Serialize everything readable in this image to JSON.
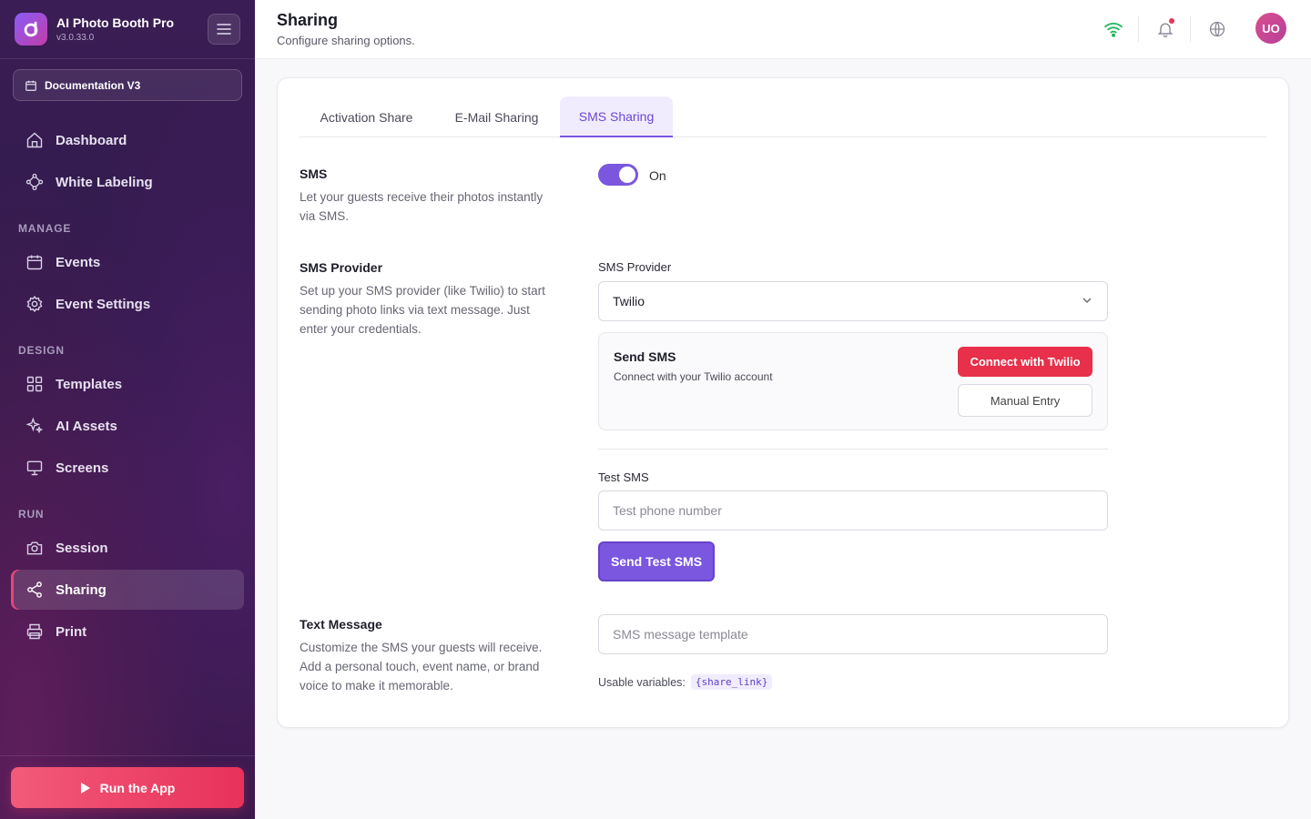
{
  "app": {
    "name": "AI Photo Booth Pro",
    "version": "v3.0.33.0"
  },
  "sidebar": {
    "project": "Documentation V3",
    "items_top": [
      {
        "label": "Dashboard",
        "icon": "home-icon"
      },
      {
        "label": "White Labeling",
        "icon": "white-label-icon"
      }
    ],
    "manage_label": "MANAGE",
    "manage_items": [
      {
        "label": "Events",
        "icon": "calendar-icon"
      },
      {
        "label": "Event Settings",
        "icon": "gear-icon"
      }
    ],
    "design_label": "DESIGN",
    "design_items": [
      {
        "label": "Templates",
        "icon": "grid-icon"
      },
      {
        "label": "AI Assets",
        "icon": "sparkles-icon"
      },
      {
        "label": "Screens",
        "icon": "monitor-icon"
      }
    ],
    "run_label": "RUN",
    "run_items": [
      {
        "label": "Session",
        "icon": "camera-icon"
      },
      {
        "label": "Sharing",
        "icon": "share-icon",
        "active": true
      },
      {
        "label": "Print",
        "icon": "printer-icon"
      }
    ],
    "run_app_label": "Run the App"
  },
  "header": {
    "title": "Sharing",
    "subtitle": "Configure sharing options.",
    "avatar_initials": "UO"
  },
  "tabs": [
    {
      "label": "Activation Share",
      "active": false
    },
    {
      "label": "E-Mail Sharing",
      "active": false
    },
    {
      "label": "SMS Sharing",
      "active": true
    }
  ],
  "sms": {
    "title": "SMS",
    "description": "Let your guests receive their photos instantly via SMS.",
    "toggle_state": "On",
    "enabled": true
  },
  "provider": {
    "title": "SMS Provider",
    "description": "Set up your SMS provider (like Twilio) to start sending photo links via text message. Just enter your credentials.",
    "field_label": "SMS Provider",
    "selected": "Twilio",
    "box_title": "Send SMS",
    "box_description": "Connect with your Twilio account",
    "connect_label": "Connect with Twilio",
    "manual_label": "Manual Entry"
  },
  "test": {
    "label": "Test SMS",
    "placeholder": "Test phone number",
    "button_label": "Send Test SMS"
  },
  "message": {
    "title": "Text Message",
    "description": "Customize the SMS your guests will receive. Add a personal touch, event name, or brand voice to make it memorable.",
    "placeholder": "SMS message template",
    "vars_label": "Usable variables:",
    "var_share_link": "{share_link}"
  },
  "colors": {
    "accent": "#7b57e0",
    "danger": "#e8304a",
    "wifi": "#22b55e"
  }
}
